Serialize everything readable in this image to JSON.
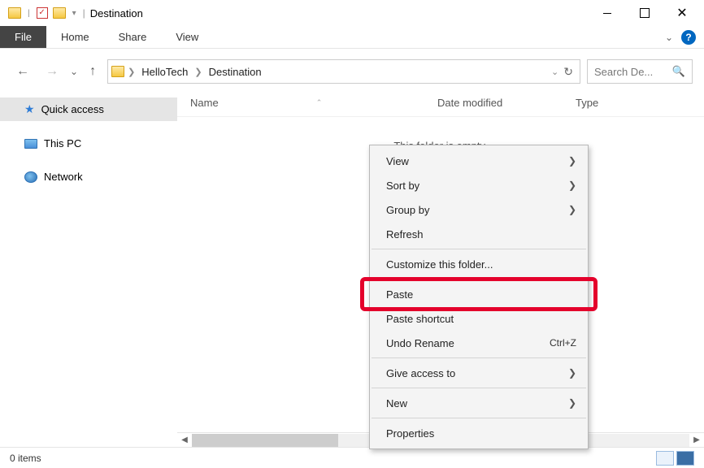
{
  "title": "Destination",
  "ribbon": {
    "file": "File",
    "tabs": [
      "Home",
      "Share",
      "View"
    ]
  },
  "breadcrumbs": [
    "HelloTech",
    "Destination"
  ],
  "search_placeholder": "Search De...",
  "sidebar": {
    "items": [
      {
        "label": "Quick access"
      },
      {
        "label": "This PC"
      },
      {
        "label": "Network"
      }
    ]
  },
  "columns": {
    "name": "Name",
    "date": "Date modified",
    "type": "Type"
  },
  "empty_text": "This folder is empty.",
  "status": {
    "items": "0 items"
  },
  "context_menu": {
    "view": "View",
    "sort_by": "Sort by",
    "group_by": "Group by",
    "refresh": "Refresh",
    "customize": "Customize this folder...",
    "paste": "Paste",
    "paste_shortcut": "Paste shortcut",
    "undo": "Undo Rename",
    "undo_key": "Ctrl+Z",
    "give_access": "Give access to",
    "new": "New",
    "properties": "Properties"
  }
}
